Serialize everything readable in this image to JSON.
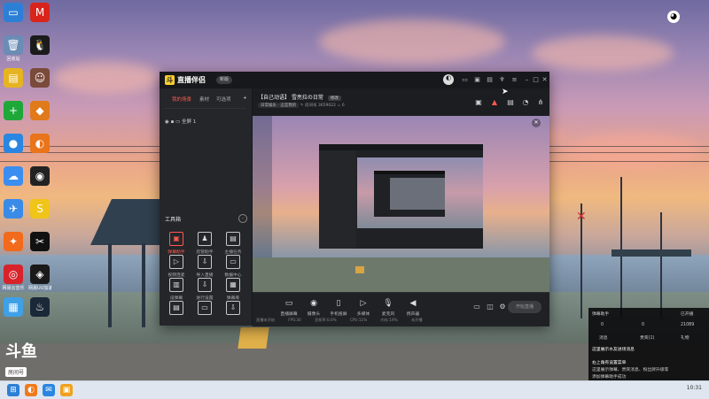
{
  "desktop": {
    "icons": [
      {
        "label": "",
        "glyph": "▭",
        "color": "#2d7fd6"
      },
      {
        "label": "",
        "glyph": "M",
        "color": "#d9241b"
      },
      {
        "label": "回收站",
        "glyph": "🗑",
        "color": "#6a8cb5"
      },
      {
        "label": "",
        "glyph": "🐧",
        "color": "#1b1b1b"
      },
      {
        "label": "",
        "glyph": "▤",
        "color": "#e6b422"
      },
      {
        "label": "",
        "glyph": "☺",
        "color": "#7a4a3a"
      },
      {
        "label": "",
        "glyph": "+",
        "color": "#1fa83a"
      },
      {
        "label": "",
        "glyph": "◆",
        "color": "#e07a1b"
      },
      {
        "label": "",
        "glyph": "●",
        "color": "#2a86e0"
      },
      {
        "label": "",
        "glyph": "◐",
        "color": "#e9741a"
      },
      {
        "label": "",
        "glyph": "☁",
        "color": "#3b8ef0"
      },
      {
        "label": "",
        "glyph": "◉",
        "color": "#222"
      },
      {
        "label": "",
        "glyph": "✈",
        "color": "#3a8be8"
      },
      {
        "label": "",
        "glyph": "S",
        "color": "#f0c419"
      },
      {
        "label": "",
        "glyph": "✦",
        "color": "#f26a1b"
      },
      {
        "label": "",
        "glyph": "✂",
        "color": "#111"
      },
      {
        "label": "网易云音乐",
        "glyph": "◎",
        "color": "#d8232a"
      },
      {
        "label": "网易UU加速器",
        "glyph": "◈",
        "color": "#1a1a1a"
      },
      {
        "label": "",
        "glyph": "▦",
        "color": "#3fa0e8"
      },
      {
        "label": "",
        "glyph": "♨",
        "color": "#1b2838"
      }
    ],
    "watermark_text": "斗鱼",
    "watermark_sub": "房间号"
  },
  "app": {
    "name": "直播伴侣",
    "version_label": "新版",
    "title_buttons": [
      "avatar",
      "message",
      "gift",
      "screen",
      "shirt",
      "menu",
      "minimize",
      "maximize",
      "close"
    ],
    "sidebar": {
      "tabs": [
        "我的场景",
        "素材",
        "可选项"
      ],
      "add_label": "+",
      "scene_name": "全屏 1",
      "tools_header": "工具箱",
      "tools": [
        {
          "label": "弹幕助手",
          "glyph": "▣",
          "hot": true
        },
        {
          "label": "房管助手",
          "glyph": "♟",
          "hot": false
        },
        {
          "label": "主播任务",
          "glyph": "▤",
          "hot": false
        },
        {
          "label": "视频连麦",
          "glyph": "▷",
          "hot": false
        },
        {
          "label": "导入直播",
          "glyph": "⇩",
          "hot": false
        },
        {
          "label": "数据中心",
          "glyph": "▭",
          "hot": false
        },
        {
          "label": "设弹幕",
          "glyph": "▥",
          "hot": false
        },
        {
          "label": "进行设置",
          "glyph": "⇩",
          "hot": false
        },
        {
          "label": "弹幕库",
          "glyph": "▦",
          "hot": false
        },
        {
          "label": "",
          "glyph": "▤",
          "hot": false
        },
        {
          "label": "",
          "glyph": "▭",
          "hot": false
        },
        {
          "label": "",
          "glyph": "⇩",
          "hot": false
        }
      ]
    },
    "room": {
      "title": "【自己动语】 雪亮拉の日常",
      "edit_label": "修改",
      "category": "日常娱乐 · 这是我的",
      "room_id": "房间号",
      "room_number": "3659022",
      "hot": "6"
    },
    "controls": [
      {
        "label": "直播屏幕",
        "glyph": "▭"
      },
      {
        "label": "摄像头",
        "glyph": "◉"
      },
      {
        "label": "手机投屏",
        "glyph": "▯"
      },
      {
        "label": "多媒体",
        "glyph": "▷"
      },
      {
        "label": "麦克风",
        "glyph": "🎙"
      },
      {
        "label": "扬声器",
        "glyph": "◀"
      }
    ],
    "start_label": "开始直播",
    "status": [
      "直播未开始",
      "FPS:30",
      "丢帧率:0.0%",
      "CPU:11%",
      "内存:19%",
      "未开播"
    ]
  },
  "widget": {
    "header": "弹幕助手",
    "tab_right": "已开播",
    "stats": [
      "0",
      "0",
      "21089"
    ],
    "tabs": [
      "消息",
      "贵宾(1)",
      "礼物"
    ],
    "notice": "这里展示水友进场消息",
    "msg1": "右上角有设置菜单",
    "msg2": "这里展示弹幕、贵宾消息、粉丝牌升级等",
    "msg3": "添加弹幕助手成功"
  },
  "taskbar": {
    "icons": [
      {
        "glyph": "⊞",
        "color": "#2d7fd6"
      },
      {
        "glyph": "◐",
        "color": "#f07a1b"
      },
      {
        "glyph": "✉",
        "color": "#2a86e0"
      },
      {
        "glyph": "▣",
        "color": "#f0a11b"
      }
    ],
    "tray": "10:31"
  }
}
